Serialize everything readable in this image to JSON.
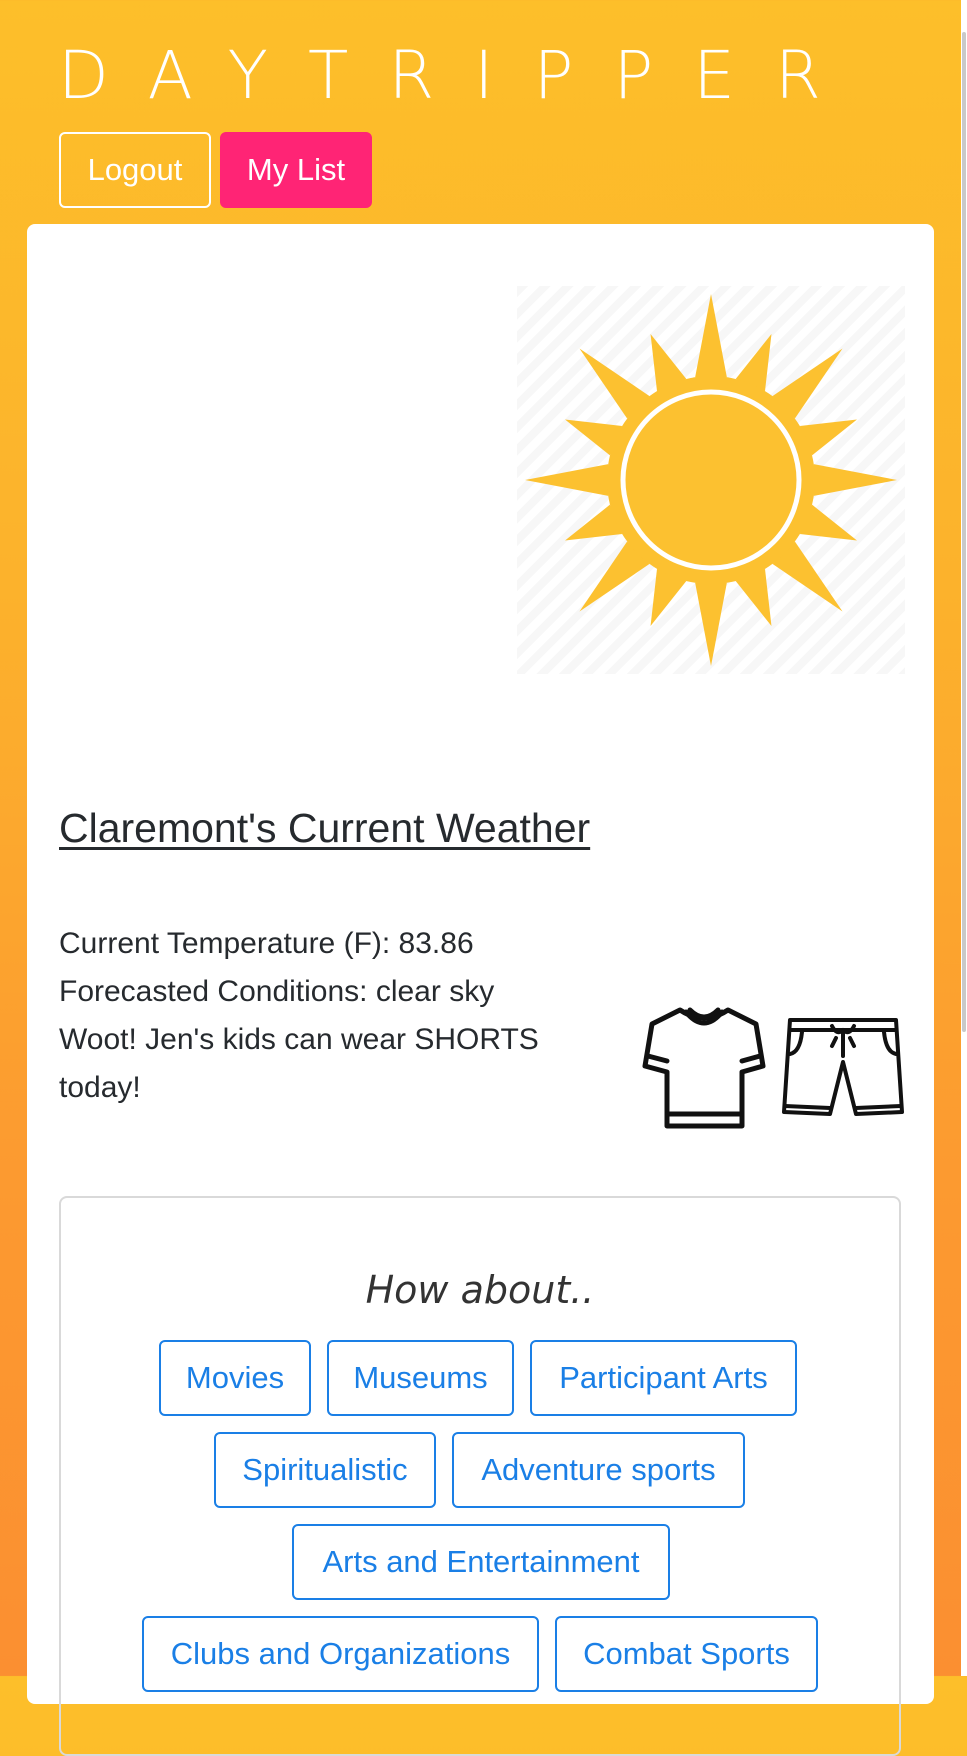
{
  "header": {
    "brand": "DAYTRIPPER",
    "logout_label": "Logout",
    "mylist_label": "My List"
  },
  "weather": {
    "title": "Claremont's Current Weather",
    "temperature_line": "Current Temperature (F): 83.86",
    "conditions_line": "Forecasted Conditions: clear sky",
    "advice_line": "Woot! Jen's kids can wear SHORTS today!",
    "icon": "sun-icon",
    "clothing_icons": [
      "tshirt-icon",
      "shorts-icon"
    ]
  },
  "suggestions": {
    "title": "How about..",
    "categories": [
      "Movies",
      "Museums",
      "Participant Arts",
      "Spiritualistic",
      "Adventure sports",
      "Arts and Entertainment",
      "Clubs and Organizations",
      "Combat Sports"
    ]
  },
  "colors": {
    "accent_pink": "#ff2475",
    "link_blue": "#1a7fe6",
    "sun_yellow": "#fcc130",
    "gradient_top": "#fdbf2a",
    "gradient_bottom": "#fb8f31"
  }
}
